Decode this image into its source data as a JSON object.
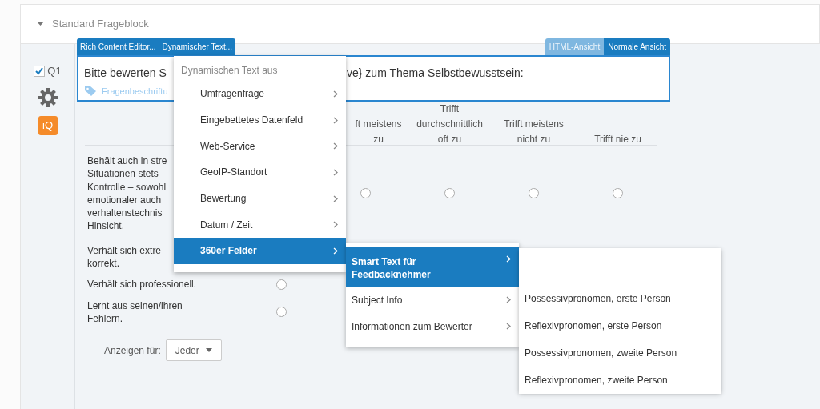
{
  "block": {
    "title": "Standard Frageblock",
    "expanded": true
  },
  "question": {
    "number": "Q1",
    "checked": true,
    "badge": "iQ",
    "toolbar": [
      "Rich Content Editor...",
      "Dynamischer Text..."
    ],
    "view_tabs": [
      {
        "label": "HTML-Ansicht",
        "selected": false
      },
      {
        "label": "Normale Ansicht",
        "selected": true
      }
    ],
    "text": [
      "Bitte bewerten S",
      "ve} zum Thema Selbstbewusstsein:"
    ],
    "label_placeholder": "Fragenbeschriftu"
  },
  "matrix": {
    "columns": [
      {
        "lines": [
          "ft meistens",
          "zu"
        ]
      },
      {
        "lines": [
          "Trifft",
          "durchschnittlich",
          "oft zu"
        ]
      },
      {
        "lines": [
          "Trifft meistens",
          "nicht zu"
        ]
      },
      {
        "lines": [
          "Trifft nie zu"
        ]
      }
    ],
    "rows": [
      {
        "lines": [
          "Behält auch in stre",
          "Situationen stets",
          "Kontrolle – sowohl",
          "emotionaler auch",
          "verhaltenstechnis",
          "Hinsicht."
        ],
        "kind": "trailing",
        "answers": [
          {
            "selected": false
          },
          {
            "selected": false
          },
          {
            "selected": false
          },
          {
            "selected": false
          }
        ]
      },
      {
        "lines": [
          "Verhält sich extre",
          "korrekt."
        ]
      },
      {
        "lines": [
          "Verhält sich professionell."
        ],
        "kind": "leading",
        "answers": [
          {
            "selected": false
          }
        ]
      },
      {
        "lines": [
          "Lernt aus seinen/ihren",
          "Fehlern."
        ],
        "kind": "leading",
        "answers": [
          {
            "selected": false
          }
        ]
      }
    ]
  },
  "show_for": {
    "label": "Anzeigen für:",
    "value": "Jeder"
  },
  "menu": {
    "header": "Dynamischen Text aus",
    "items": [
      {
        "label": "Umfragenfrage",
        "selected": false
      },
      {
        "label": "Eingebettetes Datenfeld",
        "selected": false
      },
      {
        "label": "Web-Service",
        "selected": false
      },
      {
        "label": "GeoIP-Standort",
        "selected": false
      },
      {
        "label": "Bewertung",
        "selected": false
      },
      {
        "label": "Datum / Zeit",
        "selected": false
      },
      {
        "label": "360er Felder",
        "selected": true
      }
    ]
  },
  "submenu": {
    "items": [
      {
        "label": "Smart Text für Feedbacknehmer",
        "selected": true
      },
      {
        "label": "Subject Info",
        "selected": false
      },
      {
        "label": "Informationen zum Bewerter",
        "selected": false
      }
    ]
  },
  "subsubmenu": {
    "items": [
      {
        "label": "Possessivpronomen, erste Person",
        "selected": false
      },
      {
        "label": "Reflexivpronomen, erste Person",
        "selected": false
      },
      {
        "label": "Possessivpronomen, zweite Person",
        "selected": false
      },
      {
        "label": "Reflexivpronomen, zweite Person",
        "selected": false
      }
    ]
  }
}
